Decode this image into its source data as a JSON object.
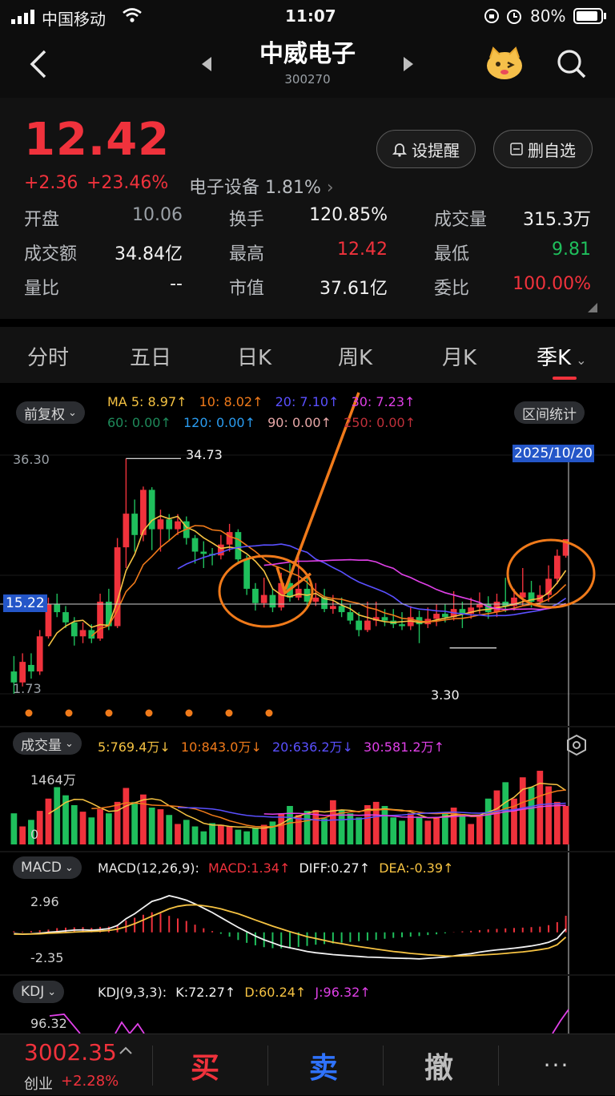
{
  "status_bar": {
    "carrier": "中国移动",
    "time": "11:07",
    "battery": "80%"
  },
  "header": {
    "stock_name": "中威电子",
    "stock_code": "300270",
    "back_icon": "back-arrow-icon",
    "prev_icon": "prev-stock-icon",
    "next_icon": "next-stock-icon",
    "mascot_icon": "mascot-icon",
    "search_icon": "search-icon"
  },
  "quote": {
    "price": "12.42",
    "change": "+2.36",
    "change_pct": "+23.46%",
    "sector": "电子设备",
    "sector_pct": "1.81%",
    "alert_button": "设提醒",
    "remove_button": "删自选",
    "stats": [
      {
        "label": "开盘",
        "value": "10.06",
        "color": "#9aa0a6"
      },
      {
        "label": "换手",
        "value": "120.85%",
        "color": "#f2f2f2"
      },
      {
        "label": "成交量",
        "value": "315.3万",
        "color": "#f2f2f2"
      },
      {
        "label": "成交额",
        "value": "34.84亿",
        "color": "#f2f2f2"
      },
      {
        "label": "最高",
        "value": "12.42",
        "color": "#f0323c"
      },
      {
        "label": "最低",
        "value": "9.81",
        "color": "#1fbf5c"
      },
      {
        "label": "量比",
        "value": "--",
        "color": "#f2f2f2"
      },
      {
        "label": "市值",
        "value": "37.61亿",
        "color": "#f2f2f2"
      },
      {
        "label": "委比",
        "value": "100.00%",
        "color": "#f0323c"
      }
    ]
  },
  "tabs": [
    "分时",
    "五日",
    "日K",
    "周K",
    "月K",
    "季K"
  ],
  "active_tab": "季K",
  "chart": {
    "adjust_chip": "前复权",
    "interval_chip": "区间统计",
    "ma_row1": [
      {
        "text": "MA 5: 8.97↑",
        "color": "#f5c242"
      },
      {
        "text": "10: 8.02↑",
        "color": "#f07a1a"
      },
      {
        "text": "20: 7.10↑",
        "color": "#5a50ff"
      },
      {
        "text": "30: 7.23↑",
        "color": "#e040e8"
      }
    ],
    "ma_row2": [
      {
        "text": "60: 0.00↑",
        "color": "#1e8a5a"
      },
      {
        "text": "120: 0.00↑",
        "color": "#2a9cf0"
      },
      {
        "text": "90: 0.00↑",
        "color": "#e8a8a8"
      },
      {
        "text": "250: 0.00↑",
        "color": "#c0303a"
      }
    ],
    "y_top": "36.30",
    "y_bottom": "1.73",
    "crosshair_price": "15.22",
    "crosshair_date": "2025/10/20",
    "high_label": "34.73",
    "low_label": "3.30",
    "volume_chip": "成交量",
    "vol_legend": [
      {
        "text": "5:769.4万↓",
        "color": "#f5c242"
      },
      {
        "text": "10:843.0万↓",
        "color": "#f07a1a"
      },
      {
        "text": "20:636.2万↓",
        "color": "#5a50ff"
      },
      {
        "text": "30:581.2万↑",
        "color": "#e040e8"
      }
    ],
    "vol_top": "1464万",
    "vol_zero": "0",
    "macd_chip": "MACD",
    "macd_legend": [
      {
        "text": "MACD(12,26,9):",
        "color": "#e8e8e8"
      },
      {
        "text": "MACD:1.34↑",
        "color": "#f0323c"
      },
      {
        "text": "DIFF:0.27↑",
        "color": "#f2f2f2"
      },
      {
        "text": "DEA:-0.39↑",
        "color": "#f5c242"
      }
    ],
    "macd_top": "2.96",
    "macd_bottom": "-2.35",
    "kdj_chip": "KDJ",
    "kdj_legend": [
      {
        "text": "KDJ(9,3,3):",
        "color": "#e8e8e8"
      },
      {
        "text": "K:72.27↑",
        "color": "#f2f2f2"
      },
      {
        "text": "D:60.24↑",
        "color": "#f5c242"
      },
      {
        "text": "J:96.32↑",
        "color": "#e040e8"
      }
    ],
    "kdj_top": "96.32"
  },
  "chart_data": {
    "type": "candlestick",
    "period": "quarterly",
    "y_range": [
      1.73,
      36.3
    ],
    "candles": [
      {
        "o": 2.3,
        "c": 2.0,
        "h": 2.8,
        "l": 1.73
      },
      {
        "o": 2.0,
        "c": 2.6,
        "h": 2.9,
        "l": 1.9
      },
      {
        "o": 2.5,
        "c": 2.3,
        "h": 2.9,
        "l": 2.1
      },
      {
        "o": 2.3,
        "c": 3.6,
        "h": 3.9,
        "l": 2.2
      },
      {
        "o": 3.6,
        "c": 5.4,
        "h": 5.9,
        "l": 3.5
      },
      {
        "o": 5.4,
        "c": 4.9,
        "h": 6.2,
        "l": 4.6
      },
      {
        "o": 4.9,
        "c": 4.3,
        "h": 5.3,
        "l": 4.0
      },
      {
        "o": 4.3,
        "c": 3.6,
        "h": 4.6,
        "l": 3.2
      },
      {
        "o": 3.6,
        "c": 3.9,
        "h": 4.3,
        "l": 3.3
      },
      {
        "o": 3.9,
        "c": 3.5,
        "h": 4.2,
        "l": 3.3
      },
      {
        "o": 3.5,
        "c": 5.6,
        "h": 6.2,
        "l": 3.4
      },
      {
        "o": 5.6,
        "c": 4.1,
        "h": 6.6,
        "l": 3.9
      },
      {
        "o": 4.1,
        "c": 11.2,
        "h": 12.6,
        "l": 4.0
      },
      {
        "o": 11.2,
        "c": 17.2,
        "h": 34.73,
        "l": 8.6
      },
      {
        "o": 17.2,
        "c": 13.1,
        "h": 20.6,
        "l": 10.6
      },
      {
        "o": 13.1,
        "c": 23.3,
        "h": 24.3,
        "l": 12.1
      },
      {
        "o": 23.3,
        "c": 14.1,
        "h": 24.1,
        "l": 10.8
      },
      {
        "o": 14.1,
        "c": 16.0,
        "h": 18.1,
        "l": 10.6
      },
      {
        "o": 16.0,
        "c": 14.1,
        "h": 17.1,
        "l": 12.1
      },
      {
        "o": 14.1,
        "c": 15.6,
        "h": 17.1,
        "l": 13.1
      },
      {
        "o": 15.6,
        "c": 12.6,
        "h": 16.6,
        "l": 11.6
      },
      {
        "o": 12.6,
        "c": 10.6,
        "h": 13.1,
        "l": 9.1
      },
      {
        "o": 10.6,
        "c": 10.3,
        "h": 12.1,
        "l": 8.6
      },
      {
        "o": 10.3,
        "c": 10.1,
        "h": 11.1,
        "l": 8.9
      },
      {
        "o": 10.1,
        "c": 11.6,
        "h": 13.1,
        "l": 9.6
      },
      {
        "o": 11.6,
        "c": 13.6,
        "h": 15.1,
        "l": 10.6
      },
      {
        "o": 13.6,
        "c": 9.6,
        "h": 14.1,
        "l": 9.1
      },
      {
        "o": 9.6,
        "c": 6.6,
        "h": 10.1,
        "l": 6.1
      },
      {
        "o": 6.6,
        "c": 5.5,
        "h": 7.1,
        "l": 5.0
      },
      {
        "o": 5.5,
        "c": 6.1,
        "h": 7.6,
        "l": 5.2
      },
      {
        "o": 6.1,
        "c": 5.2,
        "h": 6.6,
        "l": 4.9
      },
      {
        "o": 5.2,
        "c": 7.1,
        "h": 8.1,
        "l": 5.0
      },
      {
        "o": 7.1,
        "c": 5.9,
        "h": 9.1,
        "l": 5.6
      },
      {
        "o": 5.9,
        "c": 6.6,
        "h": 10.1,
        "l": 5.7
      },
      {
        "o": 6.6,
        "c": 5.6,
        "h": 7.6,
        "l": 5.2
      },
      {
        "o": 5.6,
        "c": 5.9,
        "h": 7.1,
        "l": 5.3
      },
      {
        "o": 5.9,
        "c": 5.1,
        "h": 6.6,
        "l": 4.9
      },
      {
        "o": 5.1,
        "c": 5.3,
        "h": 6.1,
        "l": 4.8
      },
      {
        "o": 5.3,
        "c": 4.9,
        "h": 5.9,
        "l": 4.6
      },
      {
        "o": 4.9,
        "c": 4.4,
        "h": 5.4,
        "l": 4.2
      },
      {
        "o": 4.4,
        "c": 3.9,
        "h": 4.9,
        "l": 3.6
      },
      {
        "o": 3.9,
        "c": 4.4,
        "h": 5.6,
        "l": 3.8
      },
      {
        "o": 4.4,
        "c": 4.6,
        "h": 5.6,
        "l": 4.1
      },
      {
        "o": 4.6,
        "c": 4.4,
        "h": 5.1,
        "l": 4.1
      },
      {
        "o": 4.4,
        "c": 4.2,
        "h": 5.1,
        "l": 4.0
      },
      {
        "o": 4.2,
        "c": 4.1,
        "h": 4.9,
        "l": 3.9
      },
      {
        "o": 4.1,
        "c": 4.6,
        "h": 5.3,
        "l": 3.9
      },
      {
        "o": 4.6,
        "c": 4.2,
        "h": 5.0,
        "l": 3.3
      },
      {
        "o": 4.2,
        "c": 4.5,
        "h": 5.2,
        "l": 4.0
      },
      {
        "o": 4.5,
        "c": 4.8,
        "h": 5.4,
        "l": 4.1
      },
      {
        "o": 4.8,
        "c": 4.6,
        "h": 5.4,
        "l": 4.3
      },
      {
        "o": 4.6,
        "c": 5.1,
        "h": 6.4,
        "l": 4.4
      },
      {
        "o": 5.1,
        "c": 4.8,
        "h": 5.6,
        "l": 4.0
      },
      {
        "o": 4.8,
        "c": 5.2,
        "h": 5.9,
        "l": 4.5
      },
      {
        "o": 5.2,
        "c": 5.4,
        "h": 6.3,
        "l": 4.8
      },
      {
        "o": 5.4,
        "c": 4.9,
        "h": 6.0,
        "l": 4.5
      },
      {
        "o": 4.9,
        "c": 5.6,
        "h": 6.2,
        "l": 4.6
      },
      {
        "o": 5.6,
        "c": 5.3,
        "h": 7.6,
        "l": 4.9
      },
      {
        "o": 5.3,
        "c": 5.9,
        "h": 6.6,
        "l": 5.0
      },
      {
        "o": 5.9,
        "c": 6.3,
        "h": 8.6,
        "l": 5.3
      },
      {
        "o": 6.3,
        "c": 5.6,
        "h": 7.3,
        "l": 5.2
      },
      {
        "o": 5.6,
        "c": 6.1,
        "h": 6.9,
        "l": 5.3
      },
      {
        "o": 6.1,
        "c": 7.5,
        "h": 8.9,
        "l": 5.6
      },
      {
        "o": 7.5,
        "c": 10.06,
        "h": 10.9,
        "l": 7.0
      },
      {
        "o": 10.06,
        "c": 12.42,
        "h": 12.42,
        "l": 9.81
      }
    ],
    "volume": [
      380,
      220,
      300,
      410,
      560,
      700,
      600,
      480,
      400,
      330,
      430,
      380,
      520,
      690,
      520,
      610,
      450,
      430,
      360,
      250,
      300,
      220,
      160,
      260,
      240,
      220,
      180,
      160,
      200,
      240,
      280,
      380,
      470,
      360,
      410,
      420,
      320,
      540,
      420,
      380,
      330,
      480,
      520,
      470,
      330,
      290,
      380,
      340,
      290,
      330,
      380,
      450,
      370,
      250,
      340,
      560,
      660,
      760,
      560,
      820,
      700,
      900,
      710,
      520,
      470
    ],
    "macd_hist": [
      0.08,
      0.05,
      0.1,
      0.16,
      0.22,
      0.34,
      0.38,
      0.4,
      0.42,
      0.36,
      0.44,
      0.46,
      0.62,
      0.96,
      1.18,
      1.42,
      1.62,
      1.52,
      1.33,
      1.12,
      0.92,
      0.62,
      0.33,
      0.1,
      -0.12,
      -0.35,
      -0.62,
      -0.85,
      -1.05,
      -1.2,
      -1.28,
      -1.3,
      -1.25,
      -1.18,
      -1.1,
      -1.0,
      -0.95,
      -0.9,
      -0.84,
      -0.78,
      -0.72,
      -0.66,
      -0.6,
      -0.52,
      -0.45,
      -0.4,
      -0.35,
      -0.3,
      -0.22,
      -0.16,
      -0.08,
      0.02,
      0.08,
      0.12,
      0.18,
      0.24,
      0.28,
      0.32,
      0.35,
      0.38,
      0.42,
      0.46,
      0.58,
      0.82,
      1.34
    ],
    "diff": [
      -0.1,
      -0.15,
      -0.12,
      -0.08,
      0.0,
      0.05,
      0.12,
      0.18,
      0.2,
      0.16,
      0.22,
      0.3,
      0.55,
      1.1,
      1.5,
      2.0,
      2.5,
      2.7,
      2.96,
      2.8,
      2.6,
      2.3,
      1.95,
      1.6,
      1.2,
      0.8,
      0.4,
      0.05,
      -0.3,
      -0.6,
      -0.85,
      -1.1,
      -1.25,
      -1.4,
      -1.55,
      -1.65,
      -1.72,
      -1.8,
      -1.85,
      -1.9,
      -1.95,
      -2.0,
      -2.02,
      -2.05,
      -2.08,
      -2.1,
      -2.12,
      -2.15,
      -2.1,
      -2.05,
      -2.0,
      -1.9,
      -1.8,
      -1.72,
      -1.6,
      -1.5,
      -1.42,
      -1.35,
      -1.28,
      -1.2,
      -1.1,
      -0.98,
      -0.8,
      -0.5,
      0.27
    ],
    "dea": [
      -0.15,
      -0.15,
      -0.14,
      -0.12,
      -0.08,
      -0.05,
      -0.02,
      0.02,
      0.05,
      0.07,
      0.1,
      0.15,
      0.25,
      0.45,
      0.7,
      1.0,
      1.3,
      1.6,
      1.9,
      2.1,
      2.2,
      2.22,
      2.15,
      2.05,
      1.9,
      1.7,
      1.5,
      1.25,
      1.0,
      0.75,
      0.5,
      0.28,
      0.05,
      -0.15,
      -0.35,
      -0.5,
      -0.65,
      -0.8,
      -0.92,
      -1.05,
      -1.15,
      -1.25,
      -1.35,
      -1.45,
      -1.55,
      -1.62,
      -1.7,
      -1.76,
      -1.82,
      -1.86,
      -1.9,
      -1.92,
      -1.9,
      -1.88,
      -1.84,
      -1.8,
      -1.76,
      -1.7,
      -1.64,
      -1.58,
      -1.5,
      -1.4,
      -1.28,
      -1.0,
      -0.39
    ]
  },
  "bottom_bar": {
    "index_value": "3002.35",
    "index_name": "创业",
    "index_change": "+2.28%",
    "buy": "买",
    "sell": "卖",
    "cancel": "撤",
    "more": "···"
  }
}
